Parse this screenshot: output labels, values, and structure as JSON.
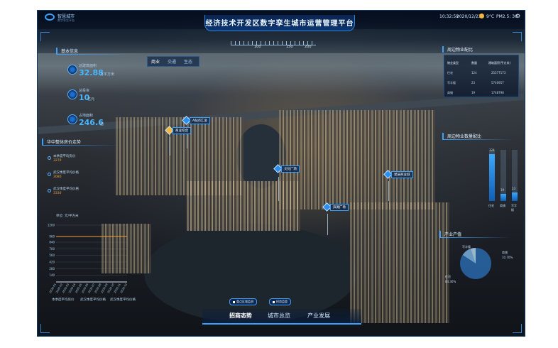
{
  "header": {
    "logo_text": "智慧城市",
    "logo_sub": "数字孪生平台",
    "title": "经济技术开发区数字孪生城市运营管理平台",
    "time": "10:32:59",
    "date": "2020/12/23",
    "temperature": "9°C",
    "pm": "PM2.5: 36"
  },
  "ruler": {
    "labels": [
      "100",
      "150",
      "200"
    ]
  },
  "basic_info": {
    "title": "基本信息",
    "items": [
      {
        "label": "总建筑面积",
        "value": "32.88",
        "unit": "万平方米"
      },
      {
        "label": "总投资",
        "value": "10",
        "unit": "亿元"
      },
      {
        "label": "占地面积",
        "value": "246.6",
        "unit": "亩"
      }
    ]
  },
  "tabs": [
    "商业",
    "交通",
    "生态"
  ],
  "price_trend": {
    "title": "华中整体房价走势",
    "items": [
      {
        "label": "本季度平均房价",
        "value": "3270"
      },
      {
        "label": "武汉季度平均价格",
        "value": "3080"
      },
      {
        "label": "武汉季度平均价格",
        "value": "3330"
      }
    ],
    "unit_label": "单位: 元/平方米",
    "legend": [
      "本季度平均房价",
      "武汉季度平均价格",
      "武汉季度平均价格"
    ]
  },
  "chart_data": {
    "type": "line",
    "x": [
      "2020-01",
      "2020-02",
      "2020-03",
      "2020-04",
      "2020-05",
      "2020-06",
      "2020-07",
      "2020-08",
      "2020-09",
      "2020-10",
      "2020-11",
      "2020-12"
    ],
    "ylim": [
      0,
      1200
    ],
    "yticks": [
      140,
      280,
      420,
      560,
      700,
      840,
      960,
      1200
    ],
    "series": [
      {
        "values": [
          960,
          960,
          960,
          960,
          960,
          960,
          960,
          960,
          960,
          960,
          960,
          960
        ],
        "color": "#f0a23a"
      },
      {
        "values": [
          0,
          0,
          0,
          0,
          0,
          0,
          0,
          0,
          0,
          0,
          0,
          0
        ],
        "color": "#9fd0ff"
      },
      {
        "values": [
          0,
          0,
          0,
          0,
          0,
          0,
          0,
          0,
          0,
          0,
          0,
          0
        ],
        "color": "#d8e8f6"
      }
    ]
  },
  "property_table": {
    "title": "周边物业配比",
    "headers": [
      "物业类型",
      "数量",
      "建筑面积(平方米)"
    ],
    "rows": [
      [
        "住宅",
        "124",
        "25577173"
      ],
      [
        "写字楼",
        "23",
        "5740957"
      ],
      [
        "商铺",
        "19",
        "1748798"
      ]
    ]
  },
  "property_count": {
    "title": "周边物业数量配比",
    "categories": [
      "住宅",
      "商铺",
      "写字楼"
    ],
    "values": [
      124,
      19,
      23
    ],
    "labels": [
      "124",
      "19",
      "23"
    ]
  },
  "industry": {
    "title": "产业产值",
    "slices": [
      {
        "label": "写字楼",
        "pct": ""
      },
      {
        "label": "商铺",
        "pct": "10.70%"
      },
      {
        "label": "住宅",
        "pct": "84.30%"
      }
    ]
  },
  "map_pins": [
    {
      "label": "A站点汇总"
    },
    {
      "label": "商业综合"
    },
    {
      "label": "文化广场"
    },
    {
      "label": "星辰商业城"
    },
    {
      "label": "滨湖广场"
    }
  ],
  "pills": [
    "重点区域监测",
    "招商监管"
  ],
  "bottom_nav": [
    "招商态势",
    "城市总览",
    "产业发展"
  ]
}
